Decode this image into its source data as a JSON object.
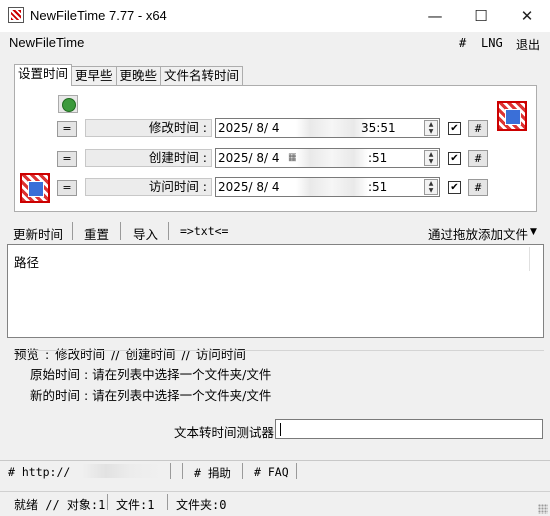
{
  "window": {
    "title": "NewFileTime 7.77 - x64",
    "minimize": "—",
    "maximize": "☐",
    "close": "✕"
  },
  "menubar": {
    "app_name": "NewFileTime",
    "items": [
      "#",
      "LNG",
      "退出"
    ]
  },
  "tabs": [
    {
      "label": "设置时间",
      "active": true
    },
    {
      "label": "更早些",
      "active": false
    },
    {
      "label": "更晚些",
      "active": false
    },
    {
      "label": "文件名转时间",
      "active": false
    }
  ],
  "time_rows": [
    {
      "eq": "=",
      "label": "修改时间 :",
      "date": "2025/  8/  4",
      "time": "35:51",
      "checked": true,
      "hash": "#"
    },
    {
      "eq": "=",
      "label": "创建时间 :",
      "date": "2025/  8/  4",
      "time": ":51",
      "checked": true,
      "hash": "#"
    },
    {
      "eq": "=",
      "label": "访问时间 :",
      "date": "2025/  8/  4",
      "time": ":51",
      "checked": true,
      "hash": "#"
    }
  ],
  "toolbar": {
    "update": "更新时间",
    "reset": "重置",
    "import": "导入",
    "txt": "=>txt<=",
    "drag_add": "通过拖放添加文件"
  },
  "filelist": {
    "column_header": "路径"
  },
  "preview": {
    "header": "预览 :  修改时间  //  创建时间  //  访问时间",
    "original_label": "原始时间 :",
    "original_value": "请在列表中选择一个文件夹/文件",
    "new_label": "新的时间 :",
    "new_value": "请在列表中选择一个文件夹/文件"
  },
  "tester": {
    "label": "文本转时间测试器",
    "value": ""
  },
  "linkbar": {
    "url": "# http://",
    "donate": "# 捐助",
    "faq": "# FAQ"
  },
  "status": {
    "ready": "就绪 // 对象:1",
    "files": "文件:1",
    "folders": "文件夹:0"
  }
}
